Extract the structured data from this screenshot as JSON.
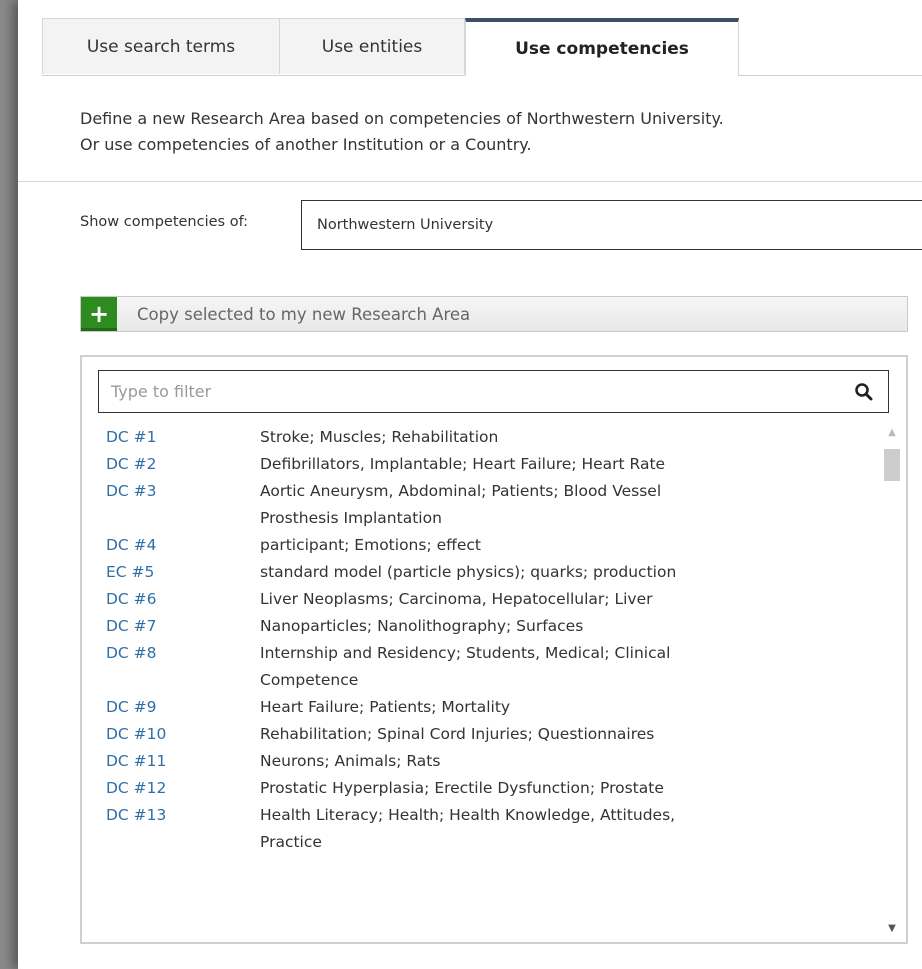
{
  "tabs": [
    {
      "label": "Use search terms"
    },
    {
      "label": "Use entities"
    },
    {
      "label": "Use competencies"
    }
  ],
  "description": {
    "line1": "Define a new Research Area based on competencies of Northwestern University.",
    "line2": "Or use competencies of another Institution or a Country."
  },
  "show": {
    "label": "Show competencies of:",
    "value": "Northwestern University"
  },
  "copy_button": {
    "icon": "plus-icon",
    "label": "Copy selected to my new Research Area"
  },
  "filter": {
    "placeholder": "Type to filter",
    "icon": "search-icon"
  },
  "competencies": [
    {
      "id": "DC #1",
      "terms": "Stroke; Muscles; Rehabilitation"
    },
    {
      "id": "DC #2",
      "terms": "Defibrillators, Implantable; Heart Failure; Heart Rate"
    },
    {
      "id": "DC #3",
      "terms": "Aortic Aneurysm, Abdominal; Patients; Blood Vessel Prosthesis Implantation"
    },
    {
      "id": "DC #4",
      "terms": "participant; Emotions; effect"
    },
    {
      "id": "EC #5",
      "terms": "standard model (particle physics); quarks; production"
    },
    {
      "id": "DC #6",
      "terms": "Liver Neoplasms; Carcinoma, Hepatocellular; Liver"
    },
    {
      "id": "DC #7",
      "terms": "Nanoparticles; Nanolithography; Surfaces"
    },
    {
      "id": "DC #8",
      "terms": "Internship and Residency; Students, Medical; Clinical Competence"
    },
    {
      "id": "DC #9",
      "terms": "Heart Failure; Patients; Mortality"
    },
    {
      "id": "DC #10",
      "terms": "Rehabilitation; Spinal Cord Injuries; Questionnaires"
    },
    {
      "id": "DC #11",
      "terms": "Neurons; Animals; Rats"
    },
    {
      "id": "DC #12",
      "terms": "Prostatic Hyperplasia; Erectile Dysfunction; Prostate"
    },
    {
      "id": "DC #13",
      "terms": "Health Literacy; Health; Health Knowledge, Attitudes, Practice"
    }
  ]
}
